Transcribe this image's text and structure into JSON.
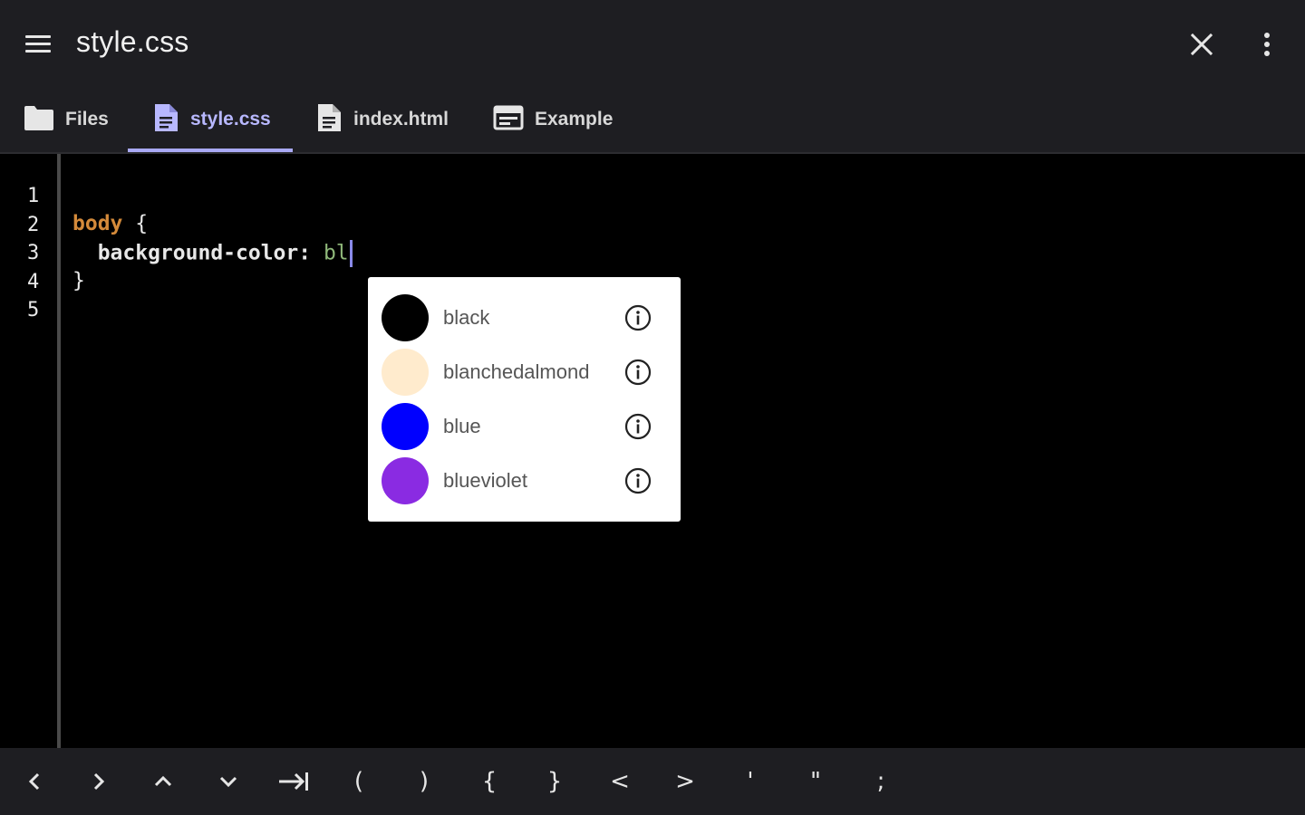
{
  "app": {
    "title": "style.css"
  },
  "tabs": [
    {
      "label": "Files",
      "icon": "folder-icon",
      "active": false
    },
    {
      "label": "style.css",
      "icon": "document-icon",
      "active": true
    },
    {
      "label": "index.html",
      "icon": "document-icon",
      "active": false
    },
    {
      "label": "Example",
      "icon": "browser-window-icon",
      "active": false
    }
  ],
  "editor": {
    "line_numbers": [
      "1",
      "2",
      "3",
      "4",
      "5"
    ],
    "lines": {
      "l2_selector": "body",
      "l2_brace": " {",
      "l3_prop": "  background-color:",
      "l3_value": " bl",
      "l4_brace": "}"
    }
  },
  "autocomplete": {
    "items": [
      {
        "label": "black",
        "color": "#000000"
      },
      {
        "label": "blanchedalmond",
        "color": "#ffebcd"
      },
      {
        "label": "blue",
        "color": "#0000ff"
      },
      {
        "label": "blueviolet",
        "color": "#8a2be2"
      }
    ]
  },
  "keybar": {
    "keys": [
      "<",
      ">",
      "^",
      "v",
      "tab",
      "(",
      ")",
      "{",
      "}",
      "<",
      ">",
      "'",
      "\"",
      ";"
    ],
    "display": [
      "‹",
      "›",
      "⌃",
      "⌄",
      "⇥",
      "(",
      ")",
      "{",
      "}",
      "<",
      ">",
      "'",
      "\"",
      ";"
    ]
  },
  "colors": {
    "appbar_bg": "#1e1e22",
    "editor_bg": "#000000",
    "accent": "#a9a9f5",
    "selector": "#d48a3a",
    "value": "#8fb87a"
  }
}
